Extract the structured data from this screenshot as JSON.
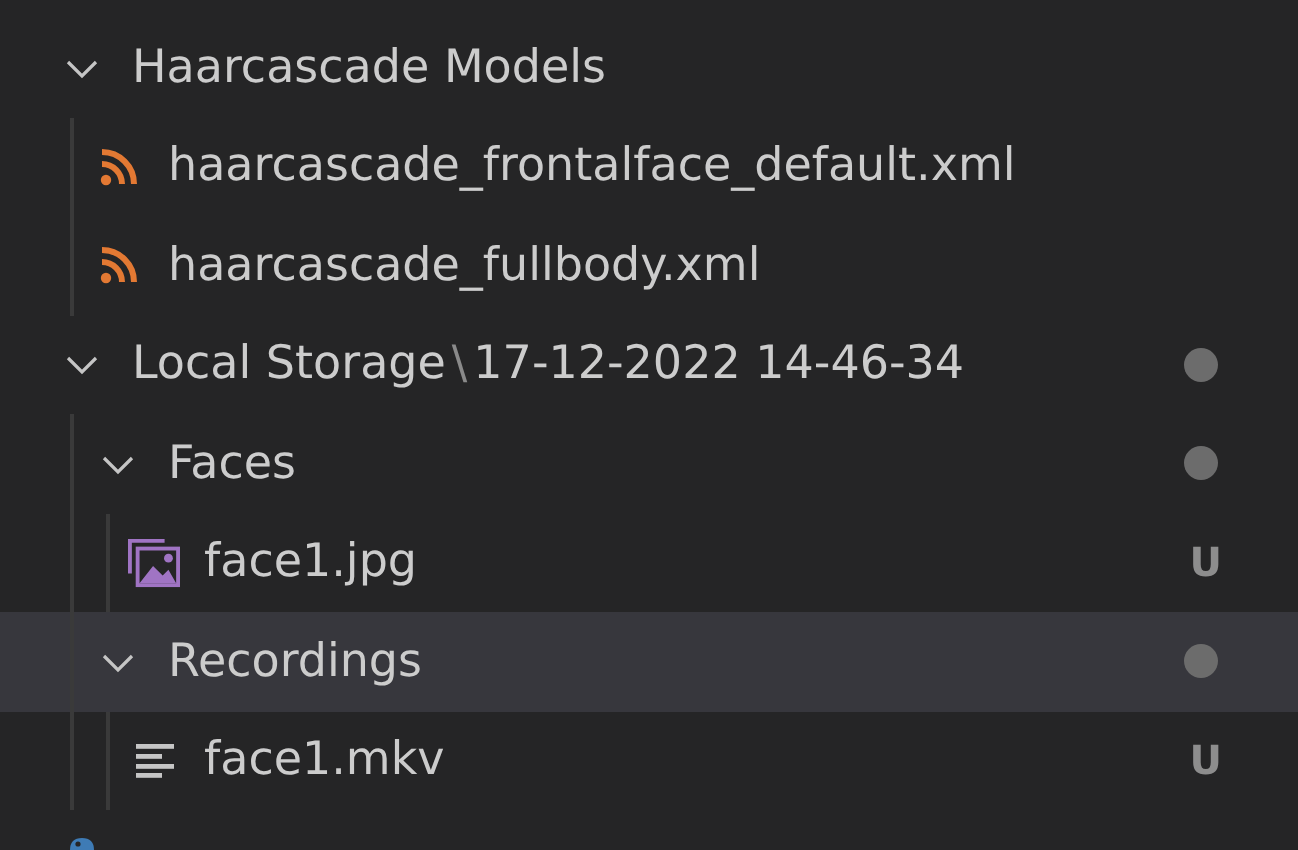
{
  "tree": [
    {
      "kind": "folder",
      "label": "Haarcascade Models",
      "expanded": true,
      "selected": false,
      "dot": false,
      "children": [
        {
          "kind": "rss",
          "label": "haarcascade_frontalface_default.xml",
          "selected": false,
          "dot": false
        },
        {
          "kind": "rss",
          "label": "haarcascade_fullbody.xml",
          "selected": false,
          "dot": false
        }
      ]
    },
    {
      "kind": "folder",
      "label": "Local Storage",
      "separator": "\\",
      "description": "17-12-2022 14-46-34",
      "expanded": true,
      "selected": false,
      "dot": true,
      "children": [
        {
          "kind": "folder",
          "label": "Faces",
          "expanded": true,
          "selected": false,
          "dot": true,
          "children": [
            {
              "kind": "image",
              "label": "face1.jpg",
              "selected": false,
              "dot": false,
              "badge": "U"
            }
          ]
        },
        {
          "kind": "folder",
          "label": "Recordings",
          "expanded": true,
          "selected": true,
          "dot": true,
          "children": [
            {
              "kind": "text",
              "label": "face1.mkv",
              "selected": false,
              "dot": false,
              "badge": "U"
            }
          ]
        }
      ]
    },
    {
      "kind": "python",
      "selected": false,
      "dot": false
    }
  ]
}
